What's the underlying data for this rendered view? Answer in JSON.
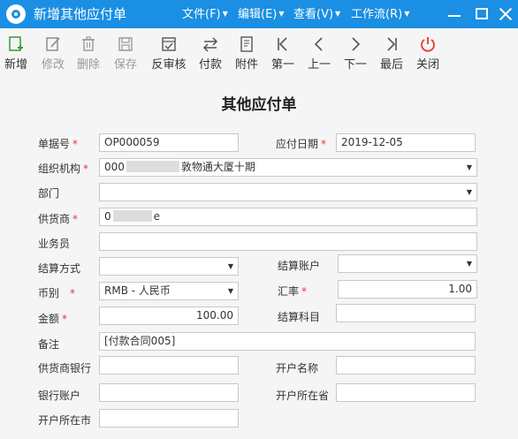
{
  "window": {
    "title": "新增其他应付单",
    "menus": [
      "文件(F)",
      "编辑(E)",
      "查看(V)",
      "工作流(R)"
    ]
  },
  "toolbar": {
    "buttons": [
      {
        "label": "新增",
        "icon": "add-doc-icon"
      },
      {
        "label": "修改",
        "icon": "edit-icon"
      },
      {
        "label": "删除",
        "icon": "trash-icon"
      },
      {
        "label": "保存",
        "icon": "save-icon"
      },
      {
        "label": "反审核",
        "icon": "unaudit-icon"
      },
      {
        "label": "付款",
        "icon": "transfer-icon"
      },
      {
        "label": "附件",
        "icon": "attachment-icon"
      },
      {
        "label": "第一",
        "icon": "first-icon"
      },
      {
        "label": "上一",
        "icon": "prev-icon"
      },
      {
        "label": "下一",
        "icon": "next-icon"
      },
      {
        "label": "最后",
        "icon": "last-icon"
      },
      {
        "label": "关闭",
        "icon": "power-icon"
      }
    ]
  },
  "form": {
    "title": "其他应付单",
    "bill_no": {
      "label": "单据号",
      "value": "OP000059"
    },
    "pay_date": {
      "label": "应付日期",
      "value": "2019-12-05"
    },
    "org": {
      "label": "组织机构",
      "value_prefix": "000",
      "value_suffix": "敦物通大厦十期"
    },
    "dept": {
      "label": "部门",
      "value": ""
    },
    "supplier": {
      "label": "供货商",
      "value_prefix": "0",
      "value_suffix": "e"
    },
    "salesman": {
      "label": "业务员",
      "value": ""
    },
    "settle_method": {
      "label": "结算方式",
      "value": ""
    },
    "settle_account": {
      "label": "结算账户",
      "value": ""
    },
    "currency": {
      "label": "币别",
      "value": "RMB - 人民币"
    },
    "rate": {
      "label": "汇率",
      "value": "1.00"
    },
    "amount": {
      "label": "金额",
      "value": "100.00"
    },
    "settle_subject": {
      "label": "结算科目",
      "value": ""
    },
    "remark": {
      "label": "备注",
      "value": "[付款合同005]"
    },
    "supplier_bank": {
      "label": "供货商银行",
      "value": ""
    },
    "account_name": {
      "label": "开户名称",
      "value": ""
    },
    "bank_account": {
      "label": "银行账户",
      "value": ""
    },
    "province": {
      "label": "开户所在省",
      "value": ""
    },
    "city": {
      "label": "开户所在市",
      "value": ""
    }
  },
  "colors": {
    "titlebar": "#1a8fe3",
    "required": "#e53935",
    "close_icon": "#e53935"
  }
}
